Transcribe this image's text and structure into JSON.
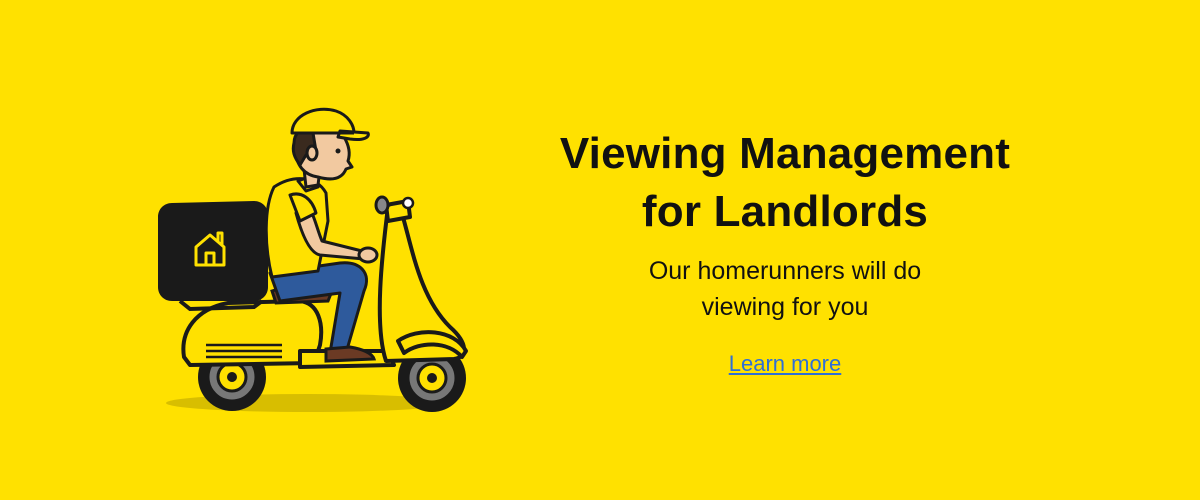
{
  "banner": {
    "headline_line1": "Viewing Management",
    "headline_line2": "for Landlords",
    "subtitle_line1": "Our homerunners will do",
    "subtitle_line2": "viewing for you",
    "cta_label": "Learn more"
  },
  "illustration": {
    "subject": "delivery-courier-on-scooter",
    "box_icon": "house-icon"
  },
  "colors": {
    "background": "#FFE100",
    "text": "#111111",
    "link": "#2F6FD6",
    "scooter": "#FFE100",
    "box": "#1A1A1A",
    "jeans": "#2E5A9C"
  }
}
